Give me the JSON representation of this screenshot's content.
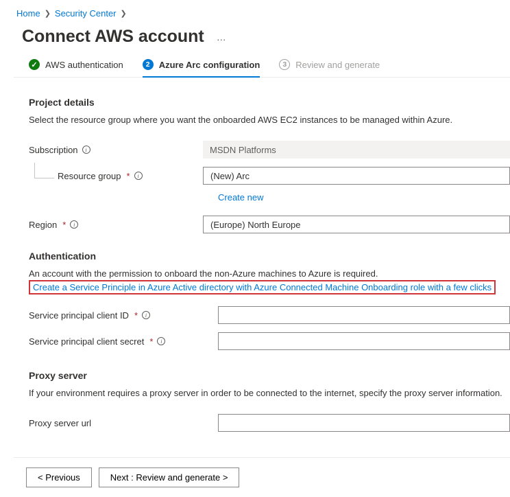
{
  "breadcrumb": {
    "home": "Home",
    "security_center": "Security Center"
  },
  "title": "Connect AWS account",
  "tabs": {
    "auth": "AWS authentication",
    "arc_num": "2",
    "arc": "Azure Arc configuration",
    "review_num": "3",
    "review": "Review and generate"
  },
  "project": {
    "heading": "Project details",
    "description": "Select the resource group where you want the onboarded AWS EC2 instances to be managed within Azure.",
    "subscription_label": "Subscription",
    "subscription_value": "MSDN Platforms",
    "resource_group_label": "Resource group",
    "resource_group_value": "(New) Arc",
    "create_new": "Create new",
    "region_label": "Region",
    "region_value": "(Europe) North Europe"
  },
  "auth": {
    "heading": "Authentication",
    "description": "An account with the permission to onboard the non-Azure machines to Azure is required.",
    "link": "Create a Service Principle in Azure Active directory with Azure Connected Machine Onboarding role with a few clicks",
    "client_id_label": "Service principal client ID",
    "client_secret_label": "Service principal client secret"
  },
  "proxy": {
    "heading": "Proxy server",
    "description": "If your environment requires a proxy server in order to be connected to the internet, specify the proxy server information.",
    "url_label": "Proxy server url"
  },
  "footer": {
    "previous": "< Previous",
    "next": "Next : Review and generate >"
  }
}
